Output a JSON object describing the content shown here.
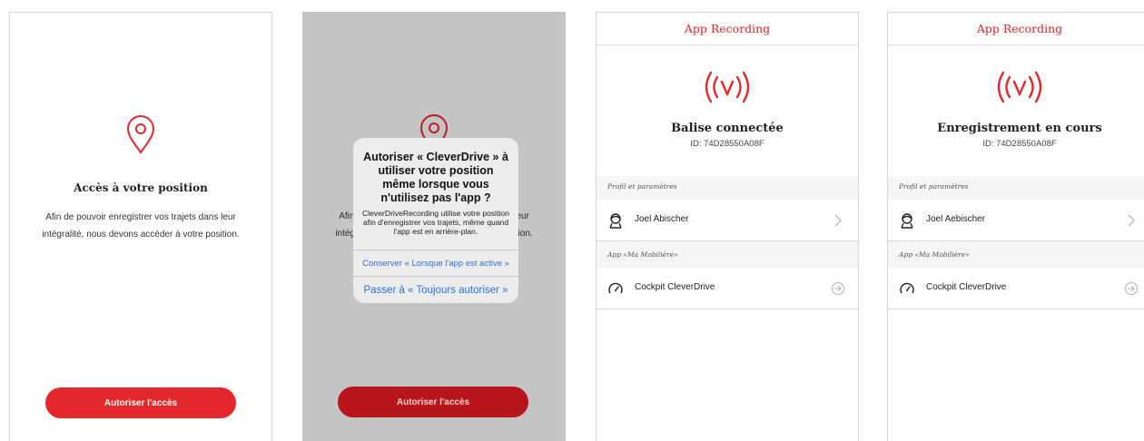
{
  "colors": {
    "accent": "#e3272c",
    "link": "#2f6fd4"
  },
  "screen1": {
    "title": "Accès à votre position",
    "description": "Afin de pouvoir enregistrer vos trajets dans leur intégralité, nous devons accéder à votre position.",
    "button": "Autoriser l'accès"
  },
  "screen2": {
    "description": "Afin de pouvoir enregistrer vos trajets dans leur intégralité, nous devons accéder à votre position.",
    "button": "Autoriser l'accès",
    "alert": {
      "title": "Autoriser « CleverDrive » à utiliser votre position même lorsque vous n'utilisez pas l'app ?",
      "message": "CleverDriveRecording utilise votre position afin d'enregistrer vos trajets, même quand l'app est en arrière-plan.",
      "option1": "Conserver « Lorsque l'app est active »",
      "option2": "Passer à « Toujours autoriser »"
    }
  },
  "screen3": {
    "nav_title": "App Recording",
    "status": "Balise connectée",
    "device_id": "ID: 74D28550A08F",
    "section1": "Profil et paramètres",
    "profile_name": "Joel Abischer",
    "section2": "App «Ma Mobilière»",
    "cockpit_label": "Cockpit CleverDrive"
  },
  "screen4": {
    "nav_title": "App Recording",
    "status": "Enregistrement en cours",
    "device_id": "ID: 74D28550A08F",
    "section1": "Profil et paramètres",
    "profile_name": "Joel Aebischer",
    "section2": "App «Ma Mobilière»",
    "cockpit_label": "Cockpit CleverDrive"
  }
}
